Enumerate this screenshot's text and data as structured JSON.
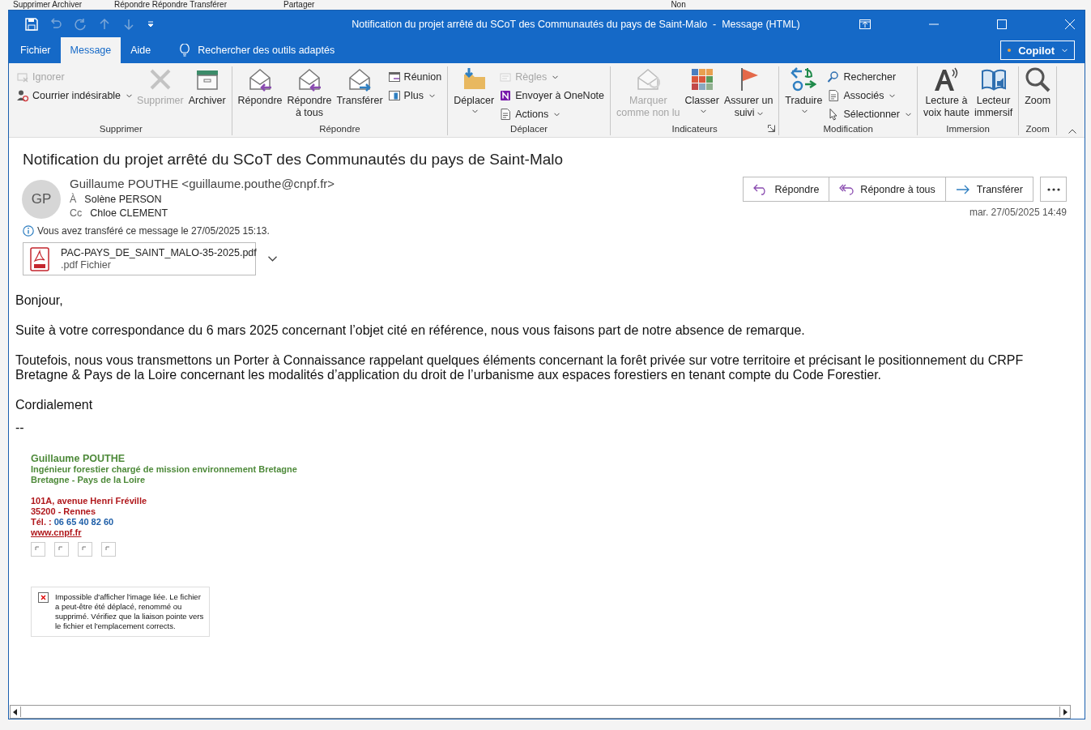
{
  "background_window": {
    "ribbon_fragments": [
      "Supprimer Archiver",
      "Répondre Répondre Transférer",
      "Partager",
      "Non"
    ]
  },
  "window": {
    "title": "Notification du projet arrêté du SCoT des Communautés du pays de Saint-Malo  -  Message (HTML)"
  },
  "tabs": [
    {
      "label": "Fichier",
      "selected": false
    },
    {
      "label": "Message",
      "selected": true
    },
    {
      "label": "Aide",
      "selected": false
    }
  ],
  "tool_search": {
    "label": "Rechercher des outils adaptés"
  },
  "copilot": {
    "label": "Copilot"
  },
  "ribbon": {
    "groups": [
      {
        "label": "Supprimer",
        "launcher": false,
        "columns": [
          {
            "kind": "stack",
            "items": [
              {
                "label": "Ignorer",
                "disabled": true,
                "dropdown": false
              },
              {
                "label": "Courrier indésirable",
                "disabled": false,
                "dropdown": true
              }
            ]
          },
          {
            "kind": "large",
            "label": "Supprimer",
            "disabled": true,
            "dropdown": false
          },
          {
            "kind": "large",
            "label": "Archiver",
            "disabled": false,
            "dropdown": false
          }
        ]
      },
      {
        "label": "Répondre",
        "launcher": false,
        "columns": [
          {
            "kind": "large",
            "label": "Répondre",
            "disabled": false,
            "dropdown": false
          },
          {
            "kind": "large",
            "label": "Répondre\nà tous",
            "disabled": false,
            "dropdown": false
          },
          {
            "kind": "large",
            "label": "Transférer",
            "disabled": false,
            "dropdown": false
          },
          {
            "kind": "stack",
            "items": [
              {
                "label": "Réunion",
                "disabled": false,
                "dropdown": false
              },
              {
                "label": "Plus",
                "disabled": false,
                "dropdown": true
              }
            ]
          }
        ]
      },
      {
        "label": "Déplacer",
        "launcher": false,
        "columns": [
          {
            "kind": "large",
            "label": "Déplacer",
            "disabled": false,
            "dropdown": true,
            "caret_below": true
          },
          {
            "kind": "stack",
            "items": [
              {
                "label": "Règles",
                "disabled": true,
                "dropdown": true
              },
              {
                "label": "Envoyer à OneNote",
                "disabled": false,
                "dropdown": false
              },
              {
                "label": "Actions",
                "disabled": false,
                "dropdown": true
              }
            ]
          }
        ]
      },
      {
        "label": "Indicateurs",
        "launcher": true,
        "columns": [
          {
            "kind": "large",
            "label": "Marquer\ncomme non lu",
            "disabled": true,
            "dropdown": false
          },
          {
            "kind": "large",
            "label": "Classer",
            "disabled": false,
            "dropdown": true,
            "caret_below": true
          },
          {
            "kind": "large",
            "label": "Assurer un\nsuivi",
            "disabled": false,
            "dropdown": true,
            "caret_below": false
          }
        ]
      },
      {
        "label": "Modification",
        "launcher": false,
        "columns": [
          {
            "kind": "large",
            "label": "Traduire",
            "disabled": false,
            "dropdown": true,
            "caret_below": true
          },
          {
            "kind": "stack",
            "items": [
              {
                "label": "Rechercher",
                "disabled": false,
                "dropdown": false
              },
              {
                "label": "Associés",
                "disabled": false,
                "dropdown": true
              },
              {
                "label": "Sélectionner",
                "disabled": false,
                "dropdown": true
              }
            ]
          }
        ]
      },
      {
        "label": "Immersion",
        "launcher": false,
        "columns": [
          {
            "kind": "large",
            "label": "Lecture à\nvoix haute",
            "disabled": false,
            "dropdown": false
          },
          {
            "kind": "large",
            "label": "Lecteur\nimmersif",
            "disabled": false,
            "dropdown": false
          }
        ]
      },
      {
        "label": "Zoom",
        "launcher": false,
        "columns": [
          {
            "kind": "large",
            "label": "Zoom",
            "disabled": false,
            "dropdown": false
          }
        ]
      }
    ]
  },
  "message": {
    "subject": "Notification du projet arrêté du SCoT des Communautés du pays de Saint-Malo",
    "avatar": "GP",
    "sender": "Guillaume POUTHE <guillaume.pouthe@cnpf.fr>",
    "to_label": "À",
    "to": "Solène PERSON",
    "cc_label": "Cc",
    "cc": "Chloe CLEMENT",
    "actions": [
      {
        "kind": "reply",
        "label": "Répondre"
      },
      {
        "kind": "replyall",
        "label": "Répondre à tous"
      },
      {
        "kind": "forward",
        "label": "Transférer"
      }
    ],
    "date": "mar. 27/05/2025 14:49",
    "info": "Vous avez transféré ce message le 27/05/2025 15:13.",
    "attachment": {
      "name": "PAC-PAYS_DE_SAINT_MALO-35-2025.pdf",
      "type": ".pdf Fichier"
    },
    "body": [
      "Bonjour,",
      "Suite à votre correspondance du 6 mars 2025 concernant l’objet cité en référence, nous vous faisons part de notre absence de remarque.",
      "Toutefois, nous vous transmettons un Porter à Connaissance rappelant quelques éléments concernant la forêt privée sur votre territoire et précisant le positionnement du CRPF Bretagne & Pays de la Loire concernant les modalités d’application du droit de l’urbanisme aux espaces forestiers en tenant compte du Code Forestier.",
      "Cordialement"
    ],
    "separator": "--",
    "signature": {
      "name": "Guillaume POUTHE",
      "role": "Ingénieur forestier chargé de mission environnement Bretagne",
      "region": "Bretagne - Pays de la Loire",
      "address": "101A, avenue Henri Fréville",
      "city": "35200 - Rennes",
      "phone_label": "Tél. : ",
      "phone": "06 65 40 82 60",
      "website": "www.cnpf.fr"
    },
    "broken_image": "Impossible d'afficher l'image liée. Le fichier a peut-être été déplacé, renommé ou supprimé. Vérifiez que la liaison pointe vers le fichier et l'emplacement corrects."
  }
}
